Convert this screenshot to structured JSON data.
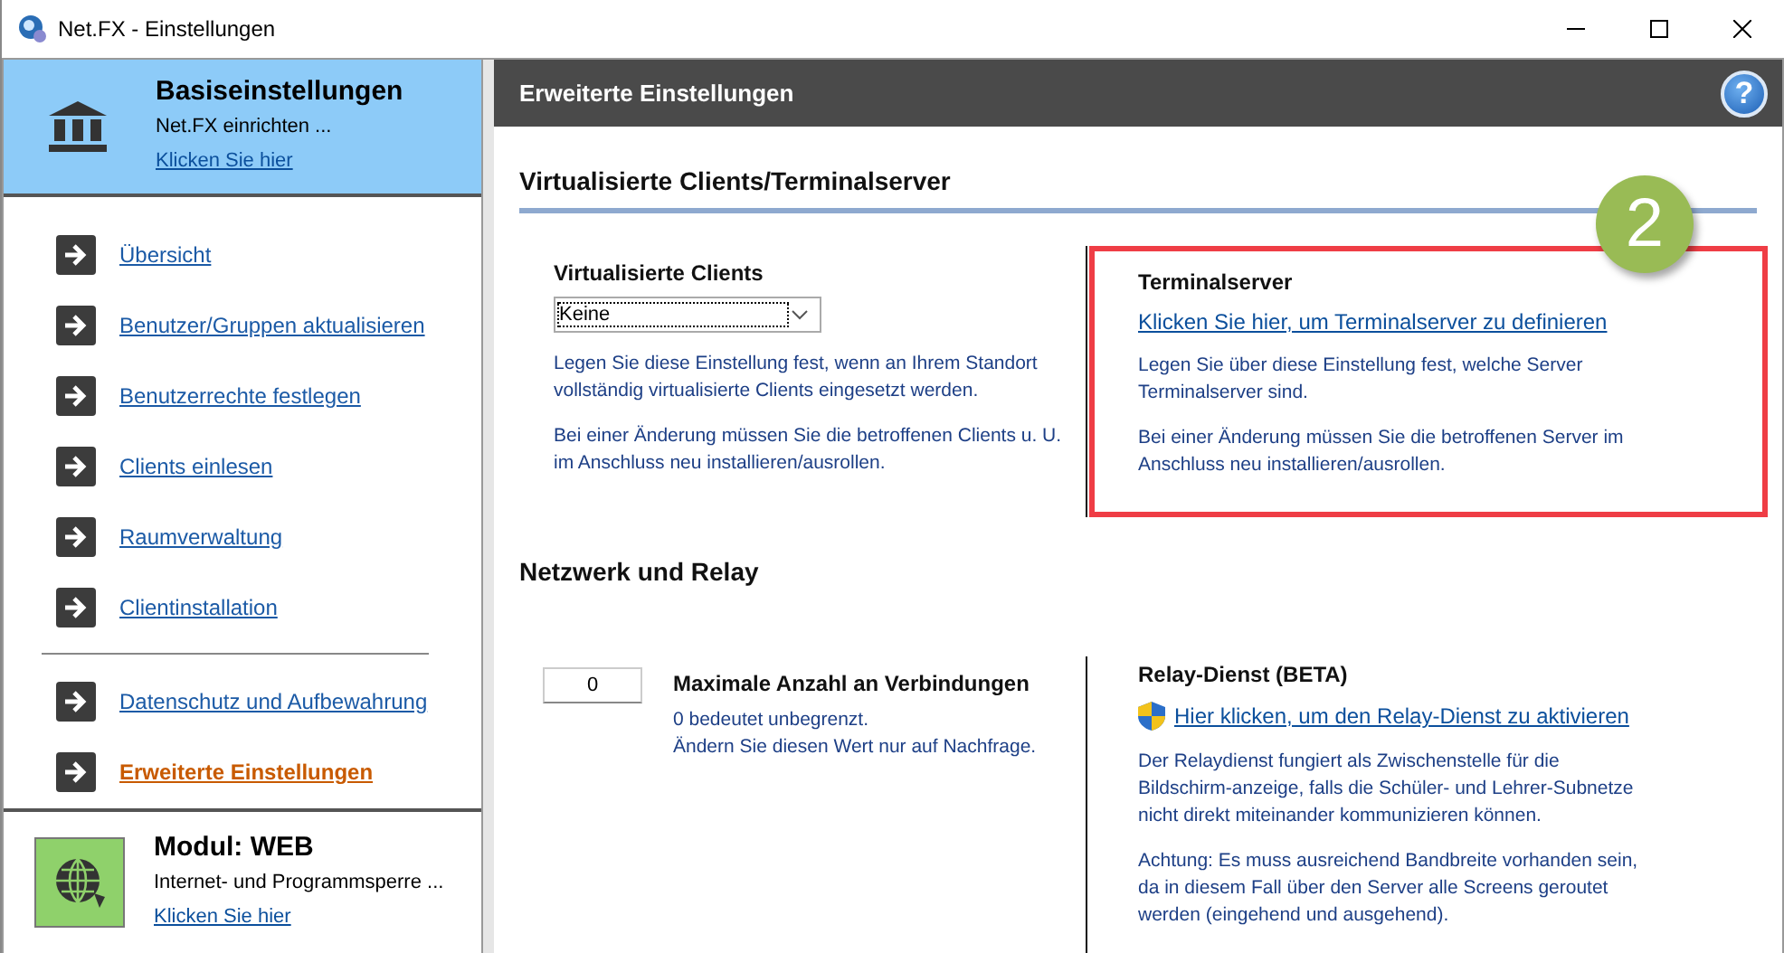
{
  "window": {
    "title": "Net.FX - Einstellungen"
  },
  "sidebar": {
    "header": {
      "title": "Basiseinstellungen",
      "subtitle": "Net.FX einrichten ...",
      "link": "Klicken Sie hier"
    },
    "nav_groups": [
      [
        {
          "label": "Übersicht",
          "selected": false
        },
        {
          "label": "Benutzer/Gruppen aktualisieren",
          "selected": false
        },
        {
          "label": "Benutzerrechte festlegen",
          "selected": false
        },
        {
          "label": "Clients einlesen",
          "selected": false
        },
        {
          "label": "Raumverwaltung",
          "selected": false
        },
        {
          "label": "Clientinstallation",
          "selected": false
        }
      ],
      [
        {
          "label": "Datenschutz und Aufbewahrung",
          "selected": false
        },
        {
          "label": "Erweiterte Einstellungen",
          "selected": true
        }
      ]
    ],
    "module": {
      "title": "Modul: WEB",
      "subtitle": "Internet- und Programmsperre ...",
      "link": "Klicken Sie hier"
    }
  },
  "panel": {
    "title": "Erweiterte Einstellungen",
    "help": "?"
  },
  "sections": [
    {
      "title": "Virtualisierte Clients/Terminalserver",
      "underlined": true,
      "left": {
        "kind": "select",
        "title": "Virtualisierte Clients",
        "value": "Keine",
        "paragraphs": [
          "Legen Sie diese Einstellung fest, wenn an Ihrem Standort vollständig virtualisierte Clients eingesetzt werden.",
          "Bei einer Änderung müssen Sie die betroffenen Clients u. U. im Anschluss neu installieren/ausrollen."
        ]
      },
      "right": {
        "title": "Terminalserver",
        "link": "Klicken Sie hier, um Terminalserver zu definieren",
        "shield": false,
        "highlighted": true,
        "callout": "2",
        "paragraphs": [
          "Legen Sie über diese Einstellung fest, welche Server Terminalserver sind.",
          "Bei einer Änderung müssen Sie die betroffenen Server im Anschluss neu installieren/ausrollen."
        ]
      }
    },
    {
      "title": "Netzwerk und Relay",
      "underlined": false,
      "left": {
        "kind": "number",
        "title": "Maximale Anzahl an Verbindungen",
        "value": "0",
        "paragraphs": [
          "0 bedeutet unbegrenzt.\nÄndern Sie diesen Wert nur auf Nachfrage."
        ]
      },
      "right": {
        "title": "Relay-Dienst (BETA)",
        "link": "Hier klicken, um den Relay-Dienst zu aktivieren",
        "shield": true,
        "highlighted": false,
        "paragraphs": [
          "Der Relaydienst fungiert als Zwischenstelle für die Bildschirm-anzeige, falls die Schüler- und Lehrer-Subnetze nicht direkt miteinander kommunizieren können.",
          "Achtung: Es muss ausreichend Bandbreite vorhanden sein, da in diesem Fall über den Server alle Screens geroutet werden (eingehend und ausgehend)."
        ]
      }
    }
  ]
}
